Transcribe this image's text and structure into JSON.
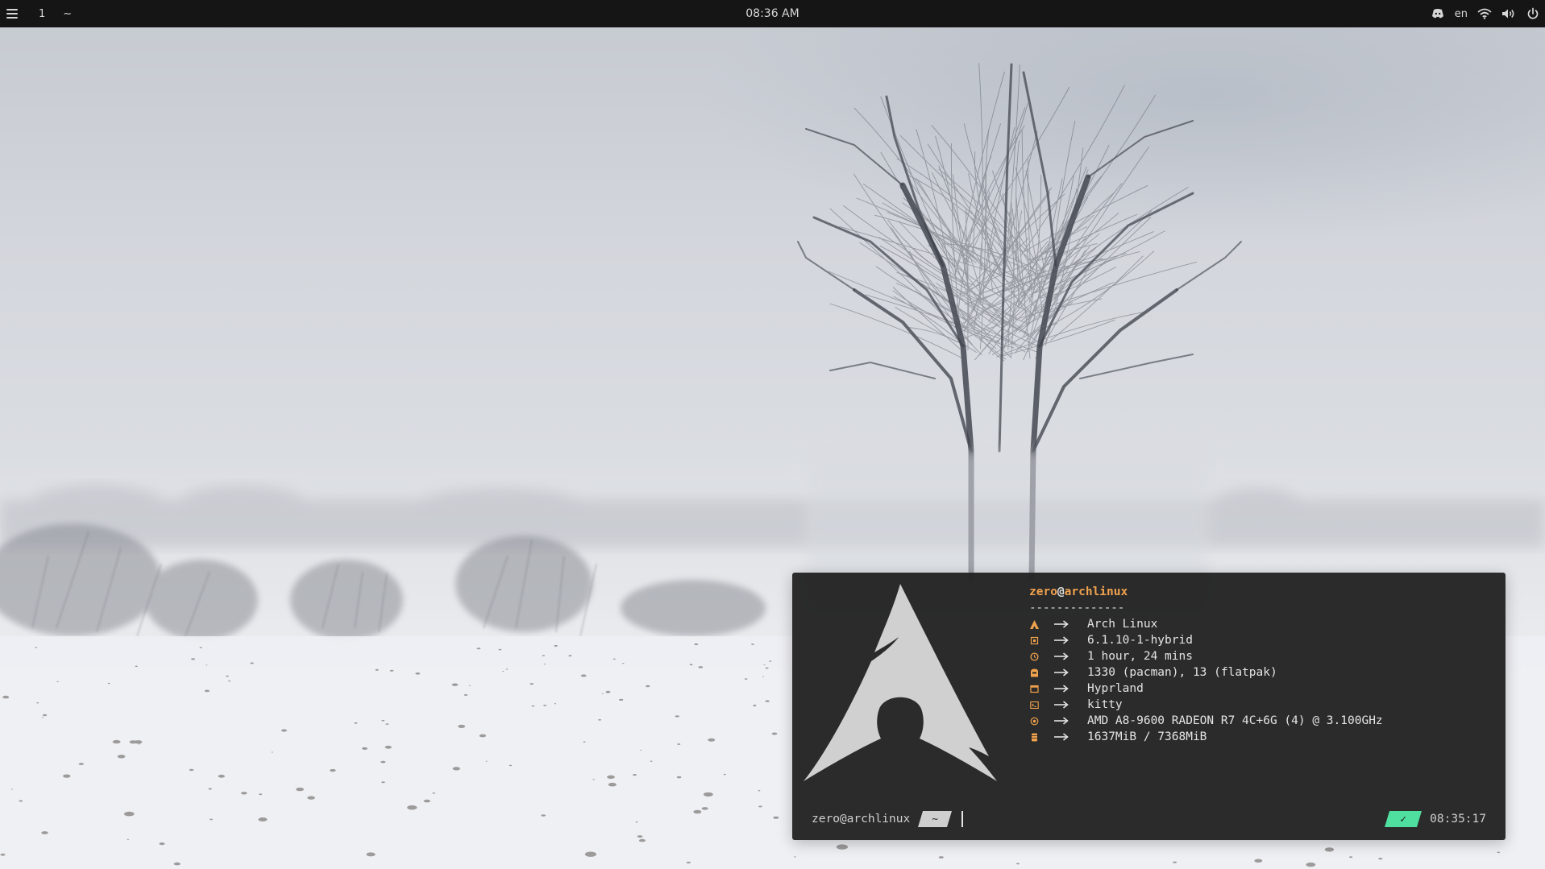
{
  "topbar": {
    "menu_icon": "hamburger-menu-icon",
    "workspace": "1",
    "cwd": "~",
    "clock": "08:36 AM",
    "language": "en",
    "tray_icons": [
      "discord-icon",
      "wifi-icon",
      "volume-icon",
      "power-icon"
    ]
  },
  "terminal": {
    "logo": "arch-linux-logo",
    "user": "zero",
    "at": "@",
    "host": "archlinux",
    "separator": "--------------",
    "arrow": "-->",
    "info": [
      {
        "icon": "arch-icon",
        "value": "Arch Linux"
      },
      {
        "icon": "kernel-chip-icon",
        "value": "6.1.10-1-hybrid"
      },
      {
        "icon": "clock-icon",
        "value": "1 hour, 24 mins"
      },
      {
        "icon": "package-icon",
        "value": "1330 (pacman), 13 (flatpak)"
      },
      {
        "icon": "window-icon",
        "value": "Hyprland"
      },
      {
        "icon": "terminal-icon",
        "value": "kitty"
      },
      {
        "icon": "cpu-icon",
        "value": "AMD A8-9600 RADEON R7 4C+6G (4) @ 3.100GHz"
      },
      {
        "icon": "memory-icon",
        "value": "1637MiB / 7368MiB"
      }
    ],
    "prompt": {
      "user_host": "zero@archlinux",
      "dir": "~",
      "status": "✓",
      "time": "08:35:17"
    }
  },
  "colors": {
    "topbar_bg": "#151515",
    "terminal_bg": "#242424",
    "accent_orange": "#f0a24d",
    "status_green": "#4fe0a0",
    "dir_chip": "#cfcfcf"
  }
}
